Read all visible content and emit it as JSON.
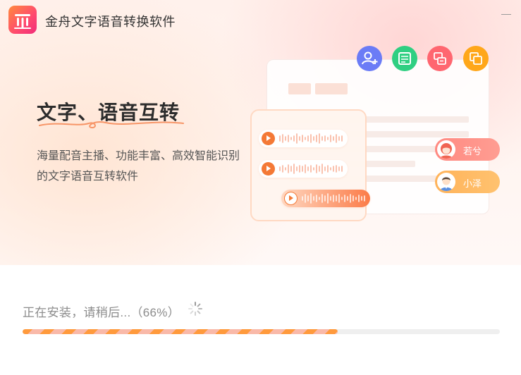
{
  "window": {
    "title": "金舟文字语音转换软件",
    "logo_icon": "app-logo-icon",
    "minimize_icon": "minimize-icon"
  },
  "hero": {
    "headline": "文字、语音互转",
    "subtitle": "海量配音主播、功能丰富、高效智能识别的文字语音互转软件",
    "action_icons": [
      {
        "name": "add-user-icon",
        "color": "#6b7cf6"
      },
      {
        "name": "document-icon",
        "color": "#2fcf82"
      },
      {
        "name": "chat-icon",
        "color": "#ff6670"
      },
      {
        "name": "layers-icon",
        "color": "#ffa71a"
      }
    ],
    "speakers": [
      {
        "name": "若兮",
        "icon": "female-avatar-icon"
      },
      {
        "name": "小泽",
        "icon": "male-avatar-icon"
      }
    ],
    "accent_color": "#f47936"
  },
  "install": {
    "status": "正在安装，请稍后...（66%）",
    "progress": 0.66,
    "spinner_icon": "loading-spinner-icon",
    "progress_colors": [
      "#ff9a3c",
      "#f9b9a9"
    ]
  }
}
